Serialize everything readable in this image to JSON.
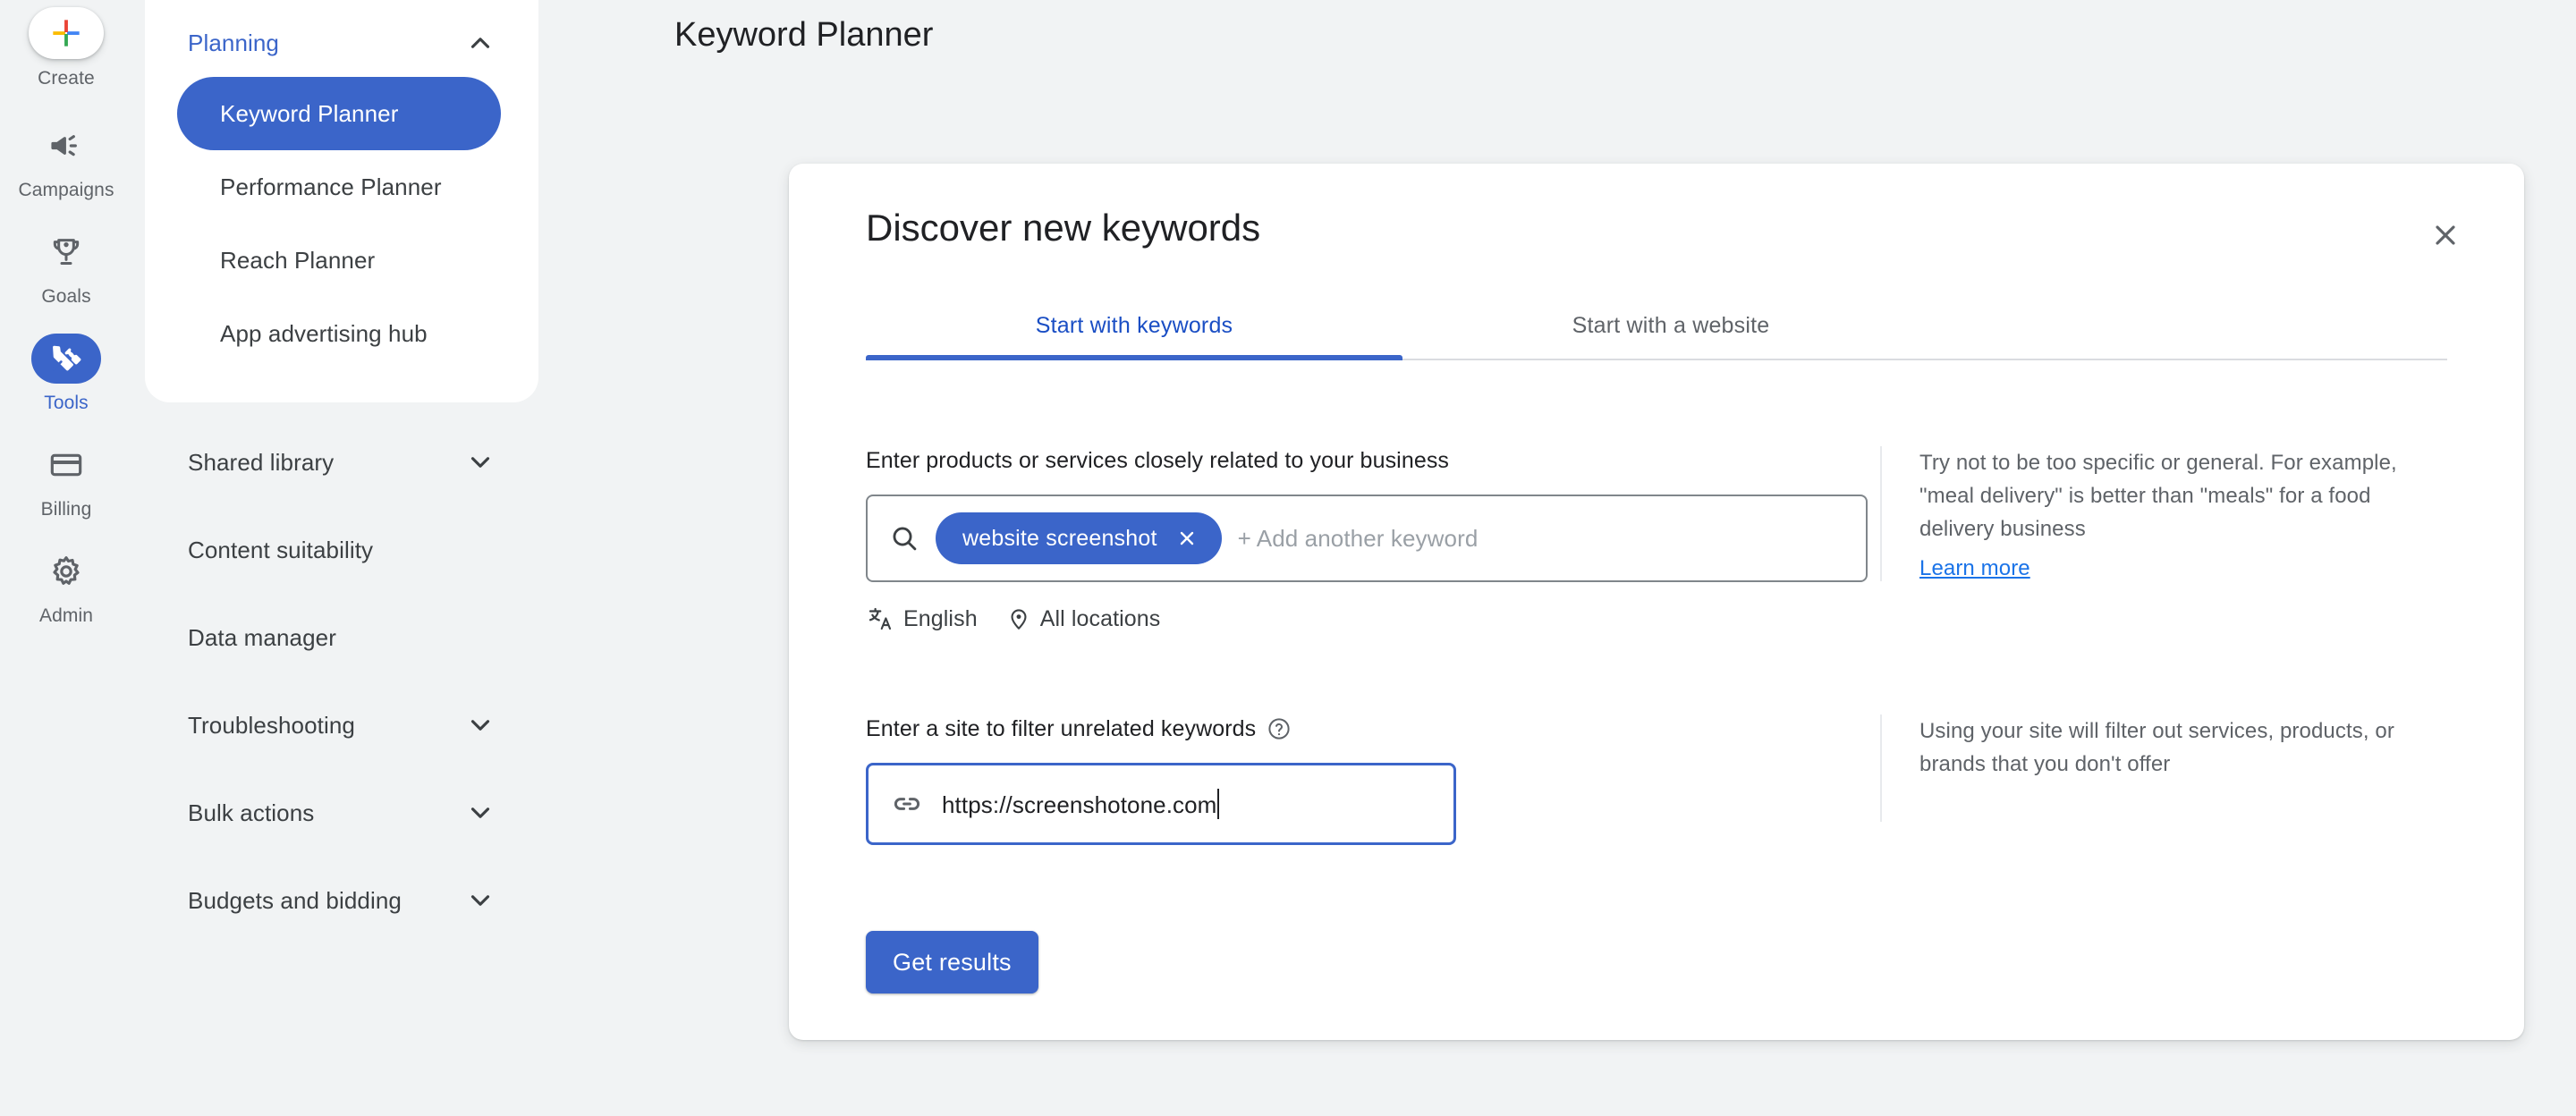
{
  "rail": {
    "items": [
      {
        "label": "Create",
        "icon": "plus-icon",
        "active": false,
        "fab": true
      },
      {
        "label": "Campaigns",
        "icon": "megaphone-icon",
        "active": false,
        "fab": false
      },
      {
        "label": "Goals",
        "icon": "trophy-icon",
        "active": false,
        "fab": false
      },
      {
        "label": "Tools",
        "icon": "tools-icon",
        "active": true,
        "fab": false
      },
      {
        "label": "Billing",
        "icon": "credit-card-icon",
        "active": false,
        "fab": false
      },
      {
        "label": "Admin",
        "icon": "gear-icon",
        "active": false,
        "fab": false
      }
    ]
  },
  "sidebar": {
    "section": {
      "title": "Planning",
      "expanded": true,
      "chevron": "chevron-up-icon"
    },
    "items": [
      {
        "label": "Keyword Planner",
        "selected": true
      },
      {
        "label": "Performance Planner",
        "selected": false
      },
      {
        "label": "Reach Planner",
        "selected": false
      },
      {
        "label": "App advertising hub",
        "selected": false
      }
    ],
    "collapsed_sections": [
      {
        "label": "Shared library",
        "chevron": "chevron-down-icon",
        "has_chevron": true
      },
      {
        "label": "Content suitability",
        "chevron": "",
        "has_chevron": false
      },
      {
        "label": "Data manager",
        "chevron": "",
        "has_chevron": false
      },
      {
        "label": "Troubleshooting",
        "chevron": "chevron-down-icon",
        "has_chevron": true
      },
      {
        "label": "Bulk actions",
        "chevron": "chevron-down-icon",
        "has_chevron": true
      },
      {
        "label": "Budgets and bidding",
        "chevron": "chevron-down-icon",
        "has_chevron": true
      }
    ]
  },
  "page": {
    "title": "Keyword Planner"
  },
  "dialog": {
    "title": "Discover new keywords",
    "close_icon": "close-icon",
    "tabs": [
      {
        "label": "Start with keywords",
        "active": true
      },
      {
        "label": "Start with a website",
        "active": false
      }
    ],
    "keywords_field": {
      "label": "Enter products or services closely related to your business",
      "search_icon": "search-icon",
      "chips": [
        {
          "text": "website screenshot",
          "remove_icon": "close-icon"
        }
      ],
      "placeholder": "+ Add another keyword",
      "language": "English",
      "language_icon": "translate-icon",
      "location": "All locations",
      "location_icon": "location-pin-icon"
    },
    "keywords_hint": {
      "text": "Try not to be too specific or general. For example, \"meal delivery\" is better than \"meals\" for a food delivery business",
      "link": "Learn more"
    },
    "site_field": {
      "label": "Enter a site to filter unrelated keywords",
      "help_icon": "help-circle-icon",
      "link_icon": "link-icon",
      "value": "https://screenshotone.com"
    },
    "site_hint": {
      "text": "Using your site will filter out services, products, or brands that you don't offer"
    },
    "submit_label": "Get results"
  },
  "colors": {
    "accent": "#3b65c9",
    "link": "#1a73e8",
    "page_bg": "#f1f3f4",
    "card_bg": "#ffffff",
    "text": "#202124",
    "muted": "#5f6368"
  }
}
